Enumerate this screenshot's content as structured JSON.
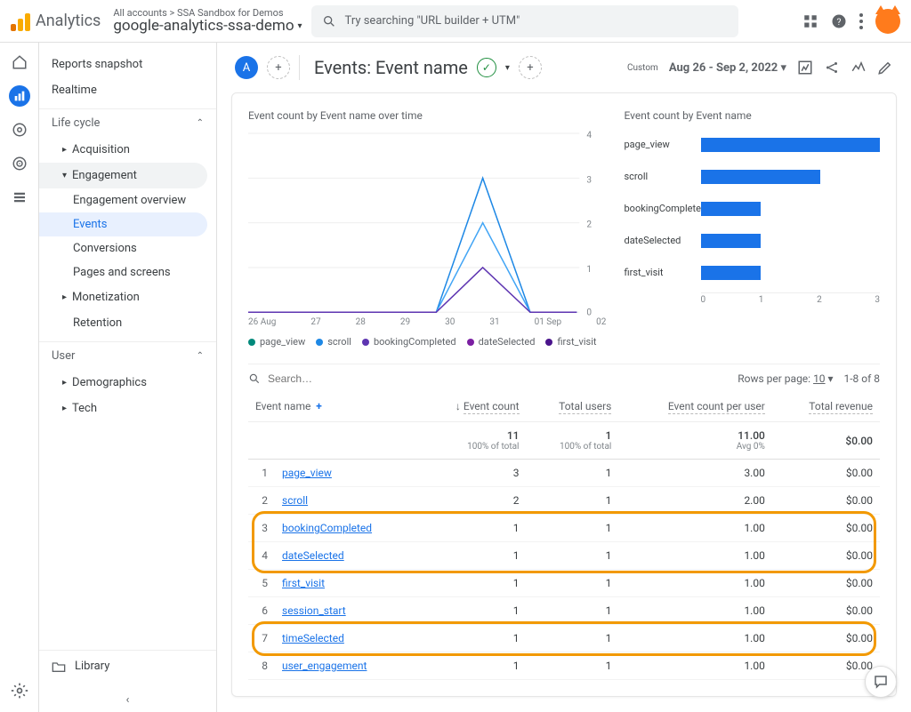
{
  "header": {
    "product": "Analytics",
    "breadcrumb_prefix": "All accounts",
    "breadcrumb_account": "SSA Sandbox for Demos",
    "property": "google-analytics-ssa-demo",
    "search_placeholder": "Try searching \"URL builder + UTM\""
  },
  "sidebar": {
    "snapshot": "Reports snapshot",
    "realtime": "Realtime",
    "life_cycle": "Life cycle",
    "acquisition": "Acquisition",
    "engagement": "Engagement",
    "engagement_overview": "Engagement overview",
    "events": "Events",
    "conversions": "Conversions",
    "pages_screens": "Pages and screens",
    "monetization": "Monetization",
    "retention": "Retention",
    "user": "User",
    "demographics": "Demographics",
    "tech": "Tech",
    "library": "Library"
  },
  "report": {
    "chip": "A",
    "title": "Events: Event name",
    "custom_label": "Custom",
    "date_range": "Aug 26 - Sep 2, 2022"
  },
  "chart_data": [
    {
      "type": "line",
      "title": "Event count by Event name over time",
      "x": [
        "26 Aug",
        "27",
        "28",
        "29",
        "30",
        "31",
        "01 Sep",
        "02"
      ],
      "ylim": [
        0,
        4
      ],
      "yticks": [
        0,
        1,
        2,
        3,
        4
      ],
      "series": [
        {
          "name": "page_view",
          "color": "#1e88e5",
          "values": [
            0,
            0,
            0,
            0,
            0,
            3,
            0,
            0
          ]
        },
        {
          "name": "scroll",
          "color": "#42a5f5",
          "values": [
            0,
            0,
            0,
            0,
            0,
            2,
            0,
            0
          ]
        },
        {
          "name": "bookingCompleted",
          "color": "#5e35b1",
          "values": [
            0,
            0,
            0,
            0,
            0,
            1,
            0,
            0
          ]
        },
        {
          "name": "dateSelected",
          "color": "#7b1fa2",
          "values": [
            0,
            0,
            0,
            0,
            0,
            1,
            0,
            0
          ]
        },
        {
          "name": "first_visit",
          "color": "#4a148c",
          "values": [
            0,
            0,
            0,
            0,
            0,
            1,
            0,
            0
          ]
        }
      ]
    },
    {
      "type": "bar",
      "title": "Event count by Event name",
      "xlim": [
        0,
        3
      ],
      "xticks": [
        0,
        1,
        2,
        3
      ],
      "categories": [
        "page_view",
        "scroll",
        "bookingCompleted",
        "dateSelected",
        "first_visit"
      ],
      "values": [
        3,
        2,
        1,
        1,
        1
      ]
    }
  ],
  "table": {
    "search_placeholder": "Search…",
    "rows_per_page_label": "Rows per page:",
    "rows_per_page": "10",
    "range": "1-8 of 8",
    "cols": {
      "name": "Event name",
      "count": "Event count",
      "users": "Total users",
      "per_user": "Event count per user",
      "revenue": "Total revenue"
    },
    "summary": {
      "count": "11",
      "count_sub": "100% of total",
      "users": "1",
      "users_sub": "100% of total",
      "per_user": "11.00",
      "per_user_sub": "Avg 0%",
      "revenue": "$0.00"
    },
    "rows": [
      {
        "n": "1",
        "name": "page_view",
        "count": "3",
        "users": "1",
        "per_user": "3.00",
        "revenue": "$0.00"
      },
      {
        "n": "2",
        "name": "scroll",
        "count": "2",
        "users": "1",
        "per_user": "2.00",
        "revenue": "$0.00"
      },
      {
        "n": "3",
        "name": "bookingCompleted",
        "count": "1",
        "users": "1",
        "per_user": "1.00",
        "revenue": "$0.00"
      },
      {
        "n": "4",
        "name": "dateSelected",
        "count": "1",
        "users": "1",
        "per_user": "1.00",
        "revenue": "$0.00"
      },
      {
        "n": "5",
        "name": "first_visit",
        "count": "1",
        "users": "1",
        "per_user": "1.00",
        "revenue": "$0.00"
      },
      {
        "n": "6",
        "name": "session_start",
        "count": "1",
        "users": "1",
        "per_user": "1.00",
        "revenue": "$0.00"
      },
      {
        "n": "7",
        "name": "timeSelected",
        "count": "1",
        "users": "1",
        "per_user": "1.00",
        "revenue": "$0.00"
      },
      {
        "n": "8",
        "name": "user_engagement",
        "count": "1",
        "users": "1",
        "per_user": "1.00",
        "revenue": "$0.00"
      }
    ]
  }
}
